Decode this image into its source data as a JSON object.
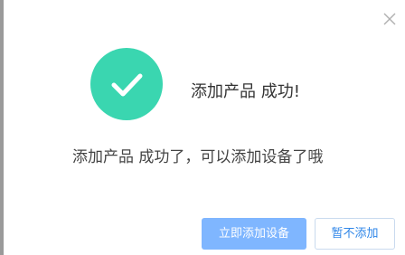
{
  "dialog": {
    "title": "添加产品 成功!",
    "message": "添加产品 成功了，可以添加设备了哦",
    "close_icon": "close-icon",
    "status_icon": "checkmark-icon",
    "success_color": "#3ad6b0",
    "buttons": {
      "add_device_label": "立即添加设备",
      "skip_label": "暂不添加"
    }
  }
}
